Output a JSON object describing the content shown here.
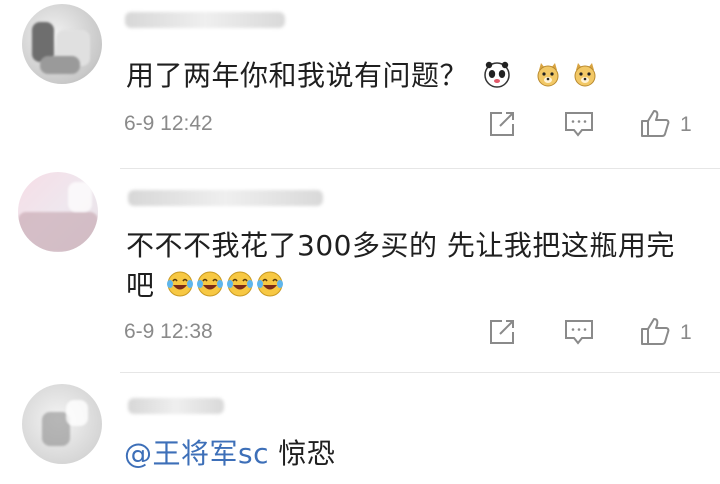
{
  "comments": [
    {
      "text": "用了两年你和我说有问题？",
      "time": "6-9 12:42",
      "likes": "1",
      "emojis": [
        "panda-face-icon",
        "doge-face-icon",
        "doge-face-icon"
      ]
    },
    {
      "text_line1": "不不不我花了300多买的 先让我把这瓶用完",
      "text_line2": "吧",
      "time": "6-9 12:38",
      "likes": "1",
      "emojis": [
        "laugh-cry-icon",
        "laugh-cry-icon",
        "laugh-cry-icon",
        "laugh-cry-icon"
      ]
    },
    {
      "mention": "@王将军sc",
      "text": "惊恐"
    }
  ],
  "actions": {
    "share_icon": "share-icon",
    "comment_icon": "comment-icon",
    "like_icon": "thumbs-up-icon"
  },
  "colors": {
    "text": "#1f1f1f",
    "meta": "#8a8a8a",
    "mention": "#3d6fb8",
    "divider": "#e6e6e6"
  }
}
